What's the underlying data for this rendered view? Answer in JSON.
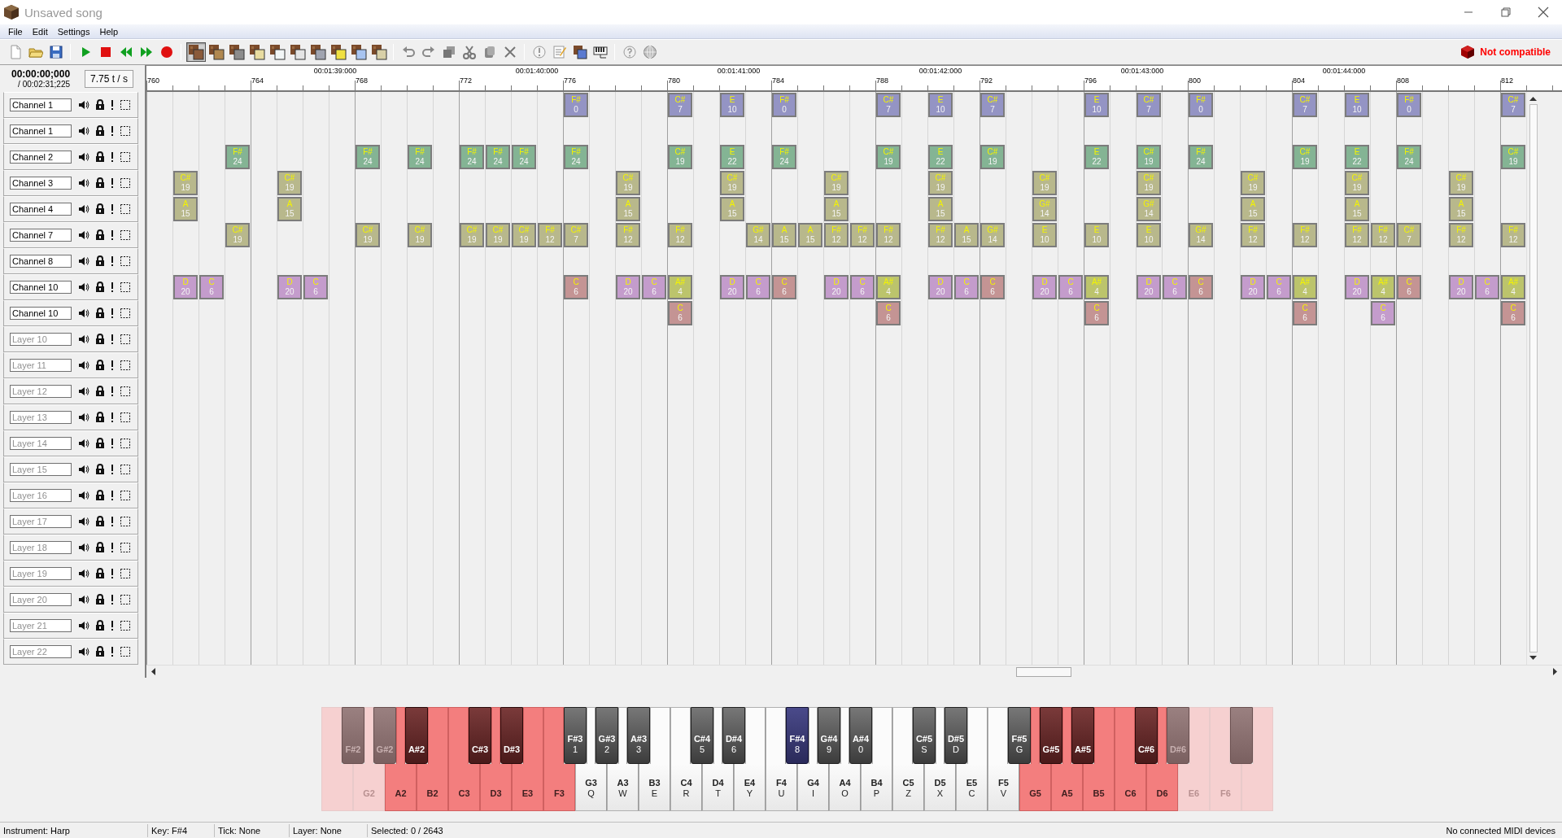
{
  "window": {
    "title": "Unsaved song"
  },
  "menu": [
    "File",
    "Edit",
    "Settings",
    "Help"
  ],
  "toolbar": {
    "instruments": [
      {
        "color": "#8a5a3a",
        "selected": true
      },
      {
        "color": "#b08850",
        "selected": false
      },
      {
        "color": "#8c8c8c",
        "selected": false
      },
      {
        "color": "#e8dca0",
        "selected": false
      },
      {
        "color": "#f2f6f6",
        "selected": false
      },
      {
        "color": "#e4e4e4",
        "selected": false
      },
      {
        "color": "#a0a4b0",
        "selected": false
      },
      {
        "color": "#f0e040",
        "selected": false
      },
      {
        "color": "#a8c4f0",
        "selected": false
      },
      {
        "color": "#d8d0a8",
        "selected": false
      }
    ],
    "compatibility": "Not compatible"
  },
  "time": {
    "current": "00:00:00;000",
    "total": "/ 00:02:31;225",
    "tempo": "7.75 t / s"
  },
  "ruler": {
    "times": [
      "00:01:39:000",
      "00:01:40:000",
      "00:01:41:000",
      "00:01:42:000",
      "00:01:43:000",
      "00:01:44:000"
    ],
    "ticks": [
      "760",
      "764",
      "768",
      "772",
      "776",
      "780",
      "784",
      "788",
      "792",
      "796",
      "800",
      "804",
      "808",
      "812"
    ]
  },
  "layers": [
    {
      "value": "Channel 1",
      "cells": [
        null,
        null,
        null,
        null,
        null,
        null,
        null,
        null,
        null,
        null,
        null,
        null,
        null,
        null,
        null,
        null,
        {
          "key": "F#",
          "pitch": "0",
          "color": "#9494c4"
        },
        null,
        null,
        null,
        {
          "key": "C#",
          "pitch": "7",
          "color": "#9494c4"
        },
        null,
        {
          "key": "E",
          "pitch": "10",
          "color": "#9494c4"
        },
        null,
        {
          "key": "F#",
          "pitch": "0",
          "color": "#9494c4"
        },
        null,
        null,
        null,
        {
          "key": "C#",
          "pitch": "7",
          "color": "#9494c4"
        },
        null,
        {
          "key": "E",
          "pitch": "10",
          "color": "#9494c4"
        },
        null,
        {
          "key": "C#",
          "pitch": "7",
          "color": "#9494c4"
        },
        null,
        null,
        null,
        {
          "key": "E",
          "pitch": "10",
          "color": "#9494c4"
        },
        null,
        {
          "key": "C#",
          "pitch": "7",
          "color": "#9494c4"
        },
        null,
        {
          "key": "F#",
          "pitch": "0",
          "color": "#9494c4"
        },
        null,
        null,
        null,
        {
          "key": "C#",
          "pitch": "7",
          "color": "#9494c4"
        },
        null,
        {
          "key": "E",
          "pitch": "10",
          "color": "#9494c4"
        },
        null,
        {
          "key": "F#",
          "pitch": "0",
          "color": "#9494c4"
        },
        null,
        null,
        null,
        {
          "key": "C#",
          "pitch": "7",
          "color": "#9494c4"
        }
      ]
    },
    {
      "value": "Channel 1"
    },
    {
      "value": "Channel 2",
      "cells": [
        null,
        null,
        null,
        {
          "key": "F#",
          "pitch": "24",
          "color": "#84b494"
        },
        null,
        null,
        null,
        null,
        {
          "key": "F#",
          "pitch": "24",
          "color": "#84b494"
        },
        null,
        {
          "key": "F#",
          "pitch": "24",
          "color": "#84b494"
        },
        null,
        {
          "key": "F#",
          "pitch": "24",
          "color": "#84b494"
        },
        {
          "key": "F#",
          "pitch": "24",
          "color": "#84b494"
        },
        {
          "key": "F#",
          "pitch": "24",
          "color": "#84b494"
        },
        null,
        {
          "key": "F#",
          "pitch": "24",
          "color": "#84b494"
        },
        null,
        null,
        null,
        {
          "key": "C#",
          "pitch": "19",
          "color": "#84b494"
        },
        null,
        {
          "key": "E",
          "pitch": "22",
          "color": "#84b494"
        },
        null,
        {
          "key": "F#",
          "pitch": "24",
          "color": "#84b494"
        },
        null,
        null,
        null,
        {
          "key": "C#",
          "pitch": "19",
          "color": "#84b494"
        },
        null,
        {
          "key": "E",
          "pitch": "22",
          "color": "#84b494"
        },
        null,
        {
          "key": "C#",
          "pitch": "19",
          "color": "#84b494"
        },
        null,
        null,
        null,
        {
          "key": "E",
          "pitch": "22",
          "color": "#84b494"
        },
        null,
        {
          "key": "C#",
          "pitch": "19",
          "color": "#84b494"
        },
        null,
        {
          "key": "F#",
          "pitch": "24",
          "color": "#84b494"
        },
        null,
        null,
        null,
        {
          "key": "C#",
          "pitch": "19",
          "color": "#84b494"
        },
        null,
        {
          "key": "E",
          "pitch": "22",
          "color": "#84b494"
        },
        null,
        {
          "key": "F#",
          "pitch": "24",
          "color": "#84b494"
        },
        null,
        null,
        null,
        {
          "key": "C#",
          "pitch": "19",
          "color": "#84b494"
        }
      ]
    },
    {
      "value": "Channel 3",
      "cells": [
        null,
        {
          "key": "C#",
          "pitch": "19",
          "color": "#b8b88c"
        },
        null,
        null,
        null,
        {
          "key": "C#",
          "pitch": "19",
          "color": "#b8b88c"
        },
        null,
        null,
        null,
        null,
        null,
        null,
        null,
        null,
        null,
        null,
        null,
        null,
        {
          "key": "C#",
          "pitch": "19",
          "color": "#b8b88c"
        },
        null,
        null,
        null,
        {
          "key": "C#",
          "pitch": "19",
          "color": "#b8b88c"
        },
        null,
        null,
        null,
        {
          "key": "C#",
          "pitch": "19",
          "color": "#b8b88c"
        },
        null,
        null,
        null,
        {
          "key": "C#",
          "pitch": "19",
          "color": "#b8b88c"
        },
        null,
        null,
        null,
        {
          "key": "C#",
          "pitch": "19",
          "color": "#b8b88c"
        },
        null,
        null,
        null,
        {
          "key": "C#",
          "pitch": "19",
          "color": "#b8b88c"
        },
        null,
        null,
        null,
        {
          "key": "C#",
          "pitch": "19",
          "color": "#b8b88c"
        },
        null,
        null,
        null,
        {
          "key": "C#",
          "pitch": "19",
          "color": "#b8b88c"
        },
        null,
        null,
        null,
        {
          "key": "C#",
          "pitch": "19",
          "color": "#b8b88c"
        },
        null,
        null
      ]
    },
    {
      "value": "Channel 4",
      "cells": [
        null,
        {
          "key": "A",
          "pitch": "15",
          "color": "#b8b88c"
        },
        null,
        null,
        null,
        {
          "key": "A",
          "pitch": "15",
          "color": "#b8b88c"
        },
        null,
        null,
        null,
        null,
        null,
        null,
        null,
        null,
        null,
        null,
        null,
        null,
        {
          "key": "A",
          "pitch": "15",
          "color": "#b8b88c"
        },
        null,
        null,
        null,
        {
          "key": "A",
          "pitch": "15",
          "color": "#b8b88c"
        },
        null,
        null,
        null,
        {
          "key": "A",
          "pitch": "15",
          "color": "#b8b88c"
        },
        null,
        null,
        null,
        {
          "key": "A",
          "pitch": "15",
          "color": "#b8b88c"
        },
        null,
        null,
        null,
        {
          "key": "G#",
          "pitch": "14",
          "color": "#b8b88c"
        },
        null,
        null,
        null,
        {
          "key": "G#",
          "pitch": "14",
          "color": "#b8b88c"
        },
        null,
        null,
        null,
        {
          "key": "A",
          "pitch": "15",
          "color": "#b8b88c"
        },
        null,
        null,
        null,
        {
          "key": "A",
          "pitch": "15",
          "color": "#b8b88c"
        },
        null,
        null,
        null,
        {
          "key": "A",
          "pitch": "15",
          "color": "#b8b88c"
        },
        null,
        null
      ]
    },
    {
      "value": "Channel 7",
      "cells": [
        null,
        null,
        null,
        {
          "key": "C#",
          "pitch": "19",
          "color": "#b8b88c"
        },
        null,
        null,
        null,
        null,
        {
          "key": "C#",
          "pitch": "19",
          "color": "#b8b88c"
        },
        null,
        {
          "key": "C#",
          "pitch": "19",
          "color": "#b8b88c"
        },
        null,
        {
          "key": "C#",
          "pitch": "19",
          "color": "#b8b88c"
        },
        {
          "key": "C#",
          "pitch": "19",
          "color": "#b8b88c"
        },
        {
          "key": "C#",
          "pitch": "19",
          "color": "#b8b88c"
        },
        {
          "key": "F#",
          "pitch": "12",
          "color": "#b8b88c"
        },
        {
          "key": "C#",
          "pitch": "7",
          "color": "#b8b88c"
        },
        null,
        {
          "key": "F#",
          "pitch": "12",
          "color": "#b8b88c"
        },
        null,
        {
          "key": "F#",
          "pitch": "12",
          "color": "#b8b88c"
        },
        null,
        null,
        {
          "key": "G#",
          "pitch": "14",
          "color": "#b8b88c"
        },
        {
          "key": "A",
          "pitch": "15",
          "color": "#b8b88c"
        },
        {
          "key": "A",
          "pitch": "15",
          "color": "#b8b88c"
        },
        {
          "key": "F#",
          "pitch": "12",
          "color": "#b8b88c"
        },
        {
          "key": "F#",
          "pitch": "12",
          "color": "#b8b88c"
        },
        {
          "key": "F#",
          "pitch": "12",
          "color": "#b8b88c"
        },
        null,
        {
          "key": "F#",
          "pitch": "12",
          "color": "#b8b88c"
        },
        {
          "key": "A",
          "pitch": "15",
          "color": "#b8b88c"
        },
        {
          "key": "G#",
          "pitch": "14",
          "color": "#b8b88c"
        },
        null,
        {
          "key": "E",
          "pitch": "10",
          "color": "#b8b88c"
        },
        null,
        {
          "key": "E",
          "pitch": "10",
          "color": "#b8b88c"
        },
        null,
        {
          "key": "E",
          "pitch": "10",
          "color": "#b8b88c"
        },
        null,
        {
          "key": "G#",
          "pitch": "14",
          "color": "#b8b88c"
        },
        null,
        {
          "key": "F#",
          "pitch": "12",
          "color": "#b8b88c"
        },
        null,
        {
          "key": "F#",
          "pitch": "12",
          "color": "#b8b88c"
        },
        null,
        {
          "key": "F#",
          "pitch": "12",
          "color": "#b8b88c"
        },
        {
          "key": "F#",
          "pitch": "12",
          "color": "#b8b88c"
        },
        {
          "key": "C#",
          "pitch": "7",
          "color": "#b8b88c"
        },
        null,
        {
          "key": "F#",
          "pitch": "12",
          "color": "#b8b88c"
        },
        null,
        {
          "key": "F#",
          "pitch": "12",
          "color": "#b8b88c"
        }
      ]
    },
    {
      "value": "Channel 8"
    },
    {
      "value": "Channel 10",
      "cells": [
        null,
        {
          "key": "D",
          "pitch": "20",
          "color": "#c49ccc"
        },
        {
          "key": "C",
          "pitch": "6",
          "color": "#c49ccc"
        },
        null,
        null,
        {
          "key": "D",
          "pitch": "20",
          "color": "#c49ccc"
        },
        {
          "key": "C",
          "pitch": "6",
          "color": "#c49ccc"
        },
        null,
        null,
        null,
        null,
        null,
        null,
        null,
        null,
        null,
        {
          "key": "C",
          "pitch": "6",
          "color": "#c49494"
        },
        null,
        {
          "key": "D",
          "pitch": "20",
          "color": "#c49ccc"
        },
        {
          "key": "C",
          "pitch": "6",
          "color": "#c49ccc"
        },
        {
          "key": "A#",
          "pitch": "4",
          "color": "#bcc46c"
        },
        null,
        {
          "key": "D",
          "pitch": "20",
          "color": "#c49ccc"
        },
        {
          "key": "C",
          "pitch": "6",
          "color": "#c49ccc"
        },
        {
          "key": "C",
          "pitch": "6",
          "color": "#c49494"
        },
        null,
        {
          "key": "D",
          "pitch": "20",
          "color": "#c49ccc"
        },
        {
          "key": "C",
          "pitch": "6",
          "color": "#c49ccc"
        },
        {
          "key": "A#",
          "pitch": "4",
          "color": "#bcc46c"
        },
        null,
        {
          "key": "D",
          "pitch": "20",
          "color": "#c49ccc"
        },
        {
          "key": "C",
          "pitch": "6",
          "color": "#c49ccc"
        },
        {
          "key": "C",
          "pitch": "6",
          "color": "#c49494"
        },
        null,
        {
          "key": "D",
          "pitch": "20",
          "color": "#c49ccc"
        },
        {
          "key": "C",
          "pitch": "6",
          "color": "#c49ccc"
        },
        {
          "key": "A#",
          "pitch": "4",
          "color": "#bcc46c"
        },
        null,
        {
          "key": "D",
          "pitch": "20",
          "color": "#c49ccc"
        },
        {
          "key": "C",
          "pitch": "6",
          "color": "#c49ccc"
        },
        {
          "key": "C",
          "pitch": "6",
          "color": "#c49494"
        },
        null,
        {
          "key": "D",
          "pitch": "20",
          "color": "#c49ccc"
        },
        {
          "key": "C",
          "pitch": "6",
          "color": "#c49ccc"
        },
        {
          "key": "A#",
          "pitch": "4",
          "color": "#bcc46c"
        },
        null,
        {
          "key": "D",
          "pitch": "20",
          "color": "#c49ccc"
        },
        {
          "key": "A#",
          "pitch": "4",
          "color": "#bcc46c"
        },
        {
          "key": "C",
          "pitch": "6",
          "color": "#c49494"
        },
        null,
        {
          "key": "D",
          "pitch": "20",
          "color": "#c49ccc"
        },
        {
          "key": "C",
          "pitch": "6",
          "color": "#c49ccc"
        },
        {
          "key": "A#",
          "pitch": "4",
          "color": "#bcc46c"
        }
      ]
    },
    {
      "value": "Channel 10",
      "cells": [
        null,
        null,
        null,
        null,
        null,
        null,
        null,
        null,
        null,
        null,
        null,
        null,
        null,
        null,
        null,
        null,
        null,
        null,
        null,
        null,
        {
          "key": "C",
          "pitch": "6",
          "color": "#c49494"
        },
        null,
        null,
        null,
        null,
        null,
        null,
        null,
        {
          "key": "C",
          "pitch": "6",
          "color": "#c49494"
        },
        null,
        null,
        null,
        null,
        null,
        null,
        null,
        {
          "key": "C",
          "pitch": "6",
          "color": "#c49494"
        },
        null,
        null,
        null,
        null,
        null,
        null,
        null,
        {
          "key": "C",
          "pitch": "6",
          "color": "#c49494"
        },
        null,
        null,
        {
          "key": "C",
          "pitch": "6",
          "color": "#c49ccc"
        },
        null,
        null,
        null,
        null,
        {
          "key": "C",
          "pitch": "6",
          "color": "#c49494"
        }
      ]
    },
    {
      "placeholder": "Layer 10"
    },
    {
      "placeholder": "Layer 11"
    },
    {
      "placeholder": "Layer 12"
    },
    {
      "placeholder": "Layer 13"
    },
    {
      "placeholder": "Layer 14"
    },
    {
      "placeholder": "Layer 15"
    },
    {
      "placeholder": "Layer 16"
    },
    {
      "placeholder": "Layer 17"
    },
    {
      "placeholder": "Layer 18"
    },
    {
      "placeholder": "Layer 19"
    },
    {
      "placeholder": "Layer 20"
    },
    {
      "placeholder": "Layer 21"
    },
    {
      "placeholder": "Layer 22"
    }
  ],
  "piano": {
    "keys": [
      {
        "kind": "natural",
        "in_range": false,
        "disabled": true,
        "selected": false
      },
      {
        "kind": "sharp",
        "in_range": false,
        "disabled": true,
        "note": "F#2",
        "selected": false
      },
      {
        "kind": "natural",
        "in_range": false,
        "disabled": true,
        "note": "G2",
        "selected": false
      },
      {
        "kind": "sharp",
        "in_range": false,
        "disabled": true,
        "note": "G#2",
        "selected": false
      },
      {
        "kind": "natural",
        "in_range": false,
        "disabled": false,
        "note": "A2",
        "selected": false
      },
      {
        "kind": "sharp",
        "in_range": false,
        "disabled": false,
        "note": "A#2",
        "selected": false
      },
      {
        "kind": "natural",
        "in_range": false,
        "disabled": false,
        "note": "B2",
        "selected": false
      },
      {
        "kind": "natural",
        "in_range": false,
        "disabled": false,
        "note": "C3",
        "selected": false
      },
      {
        "kind": "sharp",
        "in_range": false,
        "disabled": false,
        "note": "C#3",
        "selected": false
      },
      {
        "kind": "natural",
        "in_range": false,
        "disabled": false,
        "note": "D3",
        "selected": false
      },
      {
        "kind": "sharp",
        "in_range": false,
        "disabled": false,
        "note": "D#3",
        "selected": false
      },
      {
        "kind": "natural",
        "in_range": false,
        "disabled": false,
        "note": "E3",
        "selected": false
      },
      {
        "kind": "natural",
        "in_range": false,
        "disabled": false,
        "note": "F3",
        "selected": false
      },
      {
        "kind": "sharp",
        "in_range": true,
        "disabled": false,
        "note": "F#3",
        "shortcut": "1",
        "selected": false
      },
      {
        "kind": "natural",
        "in_range": true,
        "disabled": false,
        "note": "G3",
        "shortcut": "Q",
        "selected": false
      },
      {
        "kind": "sharp",
        "in_range": true,
        "disabled": false,
        "note": "G#3",
        "shortcut": "2",
        "selected": false
      },
      {
        "kind": "natural",
        "in_range": true,
        "disabled": false,
        "note": "A3",
        "shortcut": "W",
        "selected": false
      },
      {
        "kind": "sharp",
        "in_range": true,
        "disabled": false,
        "note": "A#3",
        "shortcut": "3",
        "selected": false
      },
      {
        "kind": "natural",
        "in_range": true,
        "disabled": false,
        "note": "B3",
        "shortcut": "E",
        "selected": false
      },
      {
        "kind": "natural",
        "in_range": true,
        "disabled": false,
        "note": "C4",
        "shortcut": "R",
        "selected": false
      },
      {
        "kind": "sharp",
        "in_range": true,
        "disabled": false,
        "note": "C#4",
        "shortcut": "5",
        "selected": false
      },
      {
        "kind": "natural",
        "in_range": true,
        "disabled": false,
        "note": "D4",
        "shortcut": "T",
        "selected": false
      },
      {
        "kind": "sharp",
        "in_range": true,
        "disabled": false,
        "note": "D#4",
        "shortcut": "6",
        "selected": false
      },
      {
        "kind": "natural",
        "in_range": true,
        "disabled": false,
        "note": "E4",
        "shortcut": "Y",
        "selected": false
      },
      {
        "kind": "natural",
        "in_range": true,
        "disabled": false,
        "note": "F4",
        "shortcut": "U",
        "selected": false
      },
      {
        "kind": "sharp",
        "in_range": true,
        "disabled": false,
        "note": "F#4",
        "shortcut": "8",
        "selected": true
      },
      {
        "kind": "natural",
        "in_range": true,
        "disabled": false,
        "note": "G4",
        "shortcut": "I",
        "selected": false
      },
      {
        "kind": "sharp",
        "in_range": true,
        "disabled": false,
        "note": "G#4",
        "shortcut": "9",
        "selected": false
      },
      {
        "kind": "natural",
        "in_range": true,
        "disabled": false,
        "note": "A4",
        "shortcut": "O",
        "selected": false
      },
      {
        "kind": "sharp",
        "in_range": true,
        "disabled": false,
        "note": "A#4",
        "shortcut": "0",
        "selected": false
      },
      {
        "kind": "natural",
        "in_range": true,
        "disabled": false,
        "note": "B4",
        "shortcut": "P",
        "selected": false
      },
      {
        "kind": "natural",
        "in_range": true,
        "disabled": false,
        "note": "C5",
        "shortcut": "Z",
        "selected": false
      },
      {
        "kind": "sharp",
        "in_range": true,
        "disabled": false,
        "note": "C#5",
        "shortcut": "S",
        "selected": false
      },
      {
        "kind": "natural",
        "in_range": true,
        "disabled": false,
        "note": "D5",
        "shortcut": "X",
        "selected": false
      },
      {
        "kind": "sharp",
        "in_range": true,
        "disabled": false,
        "note": "D#5",
        "shortcut": "D",
        "selected": false
      },
      {
        "kind": "natural",
        "in_range": true,
        "disabled": false,
        "note": "E5",
        "shortcut": "C",
        "selected": false
      },
      {
        "kind": "natural",
        "in_range": true,
        "disabled": false,
        "note": "F5",
        "shortcut": "V",
        "selected": false
      },
      {
        "kind": "sharp",
        "in_range": true,
        "disabled": false,
        "note": "F#5",
        "shortcut": "G",
        "selected": false
      },
      {
        "kind": "natural",
        "in_range": false,
        "disabled": false,
        "note": "G5",
        "selected": false
      },
      {
        "kind": "sharp",
        "in_range": false,
        "disabled": false,
        "note": "G#5",
        "selected": false
      },
      {
        "kind": "natural",
        "in_range": false,
        "disabled": false,
        "note": "A5",
        "selected": false
      },
      {
        "kind": "sharp",
        "in_range": false,
        "disabled": false,
        "note": "A#5",
        "selected": false
      },
      {
        "kind": "natural",
        "in_range": false,
        "disabled": false,
        "note": "B5",
        "selected": false
      },
      {
        "kind": "natural",
        "in_range": false,
        "disabled": false,
        "note": "C6",
        "selected": false
      },
      {
        "kind": "sharp",
        "in_range": false,
        "disabled": false,
        "note": "C#6",
        "selected": false
      },
      {
        "kind": "natural",
        "in_range": false,
        "disabled": false,
        "note": "D6",
        "selected": false
      },
      {
        "kind": "sharp",
        "in_range": false,
        "disabled": true,
        "note": "D#6",
        "selected": false
      },
      {
        "kind": "natural",
        "in_range": false,
        "disabled": true,
        "note": "E6",
        "selected": false
      },
      {
        "kind": "natural",
        "in_range": false,
        "disabled": true,
        "note": "F6",
        "selected": false
      },
      {
        "kind": "sharp",
        "in_range": false,
        "disabled": true,
        "selected": false
      },
      {
        "kind": "natural",
        "in_range": false,
        "disabled": true,
        "selected": false
      }
    ]
  },
  "status_bar": {
    "items": [
      "Instrument: Harp",
      "Key: F#4",
      "Tick: None",
      "Layer: None",
      "Selected: 0 / 2643"
    ],
    "midi": "No connected MIDI devices"
  }
}
